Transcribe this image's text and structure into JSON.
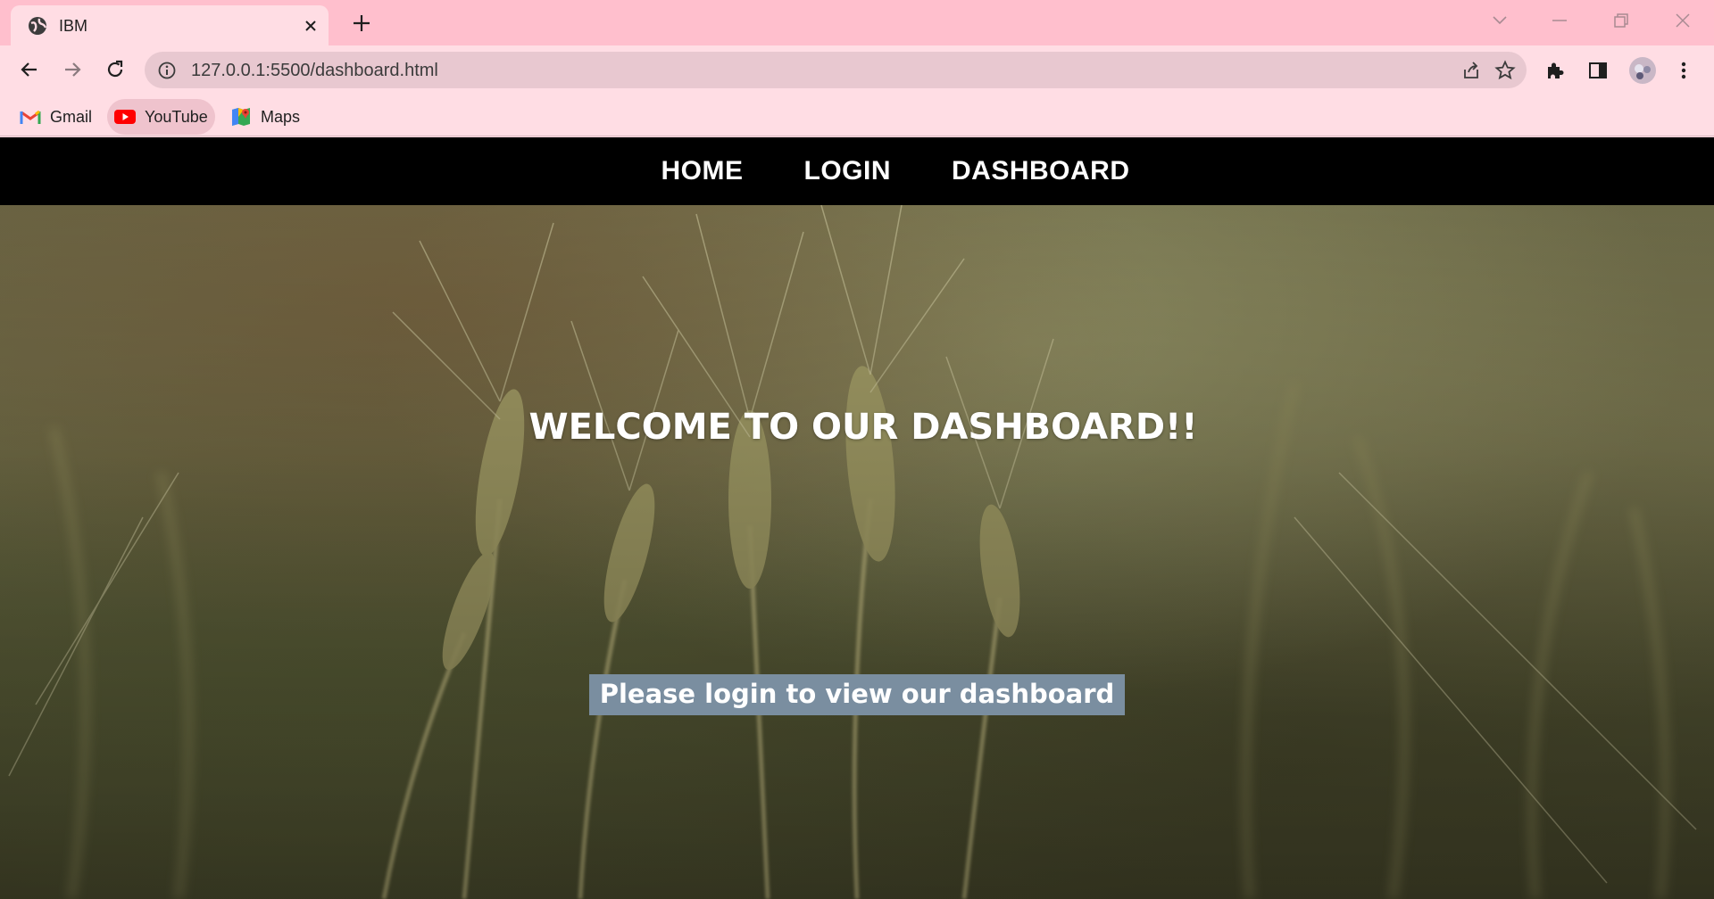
{
  "browser": {
    "tab": {
      "title": "IBM"
    },
    "address_bar": {
      "url": "127.0.0.1:5500/dashboard.html"
    },
    "bookmarks": [
      {
        "label": "Gmail",
        "icon": "gmail-icon"
      },
      {
        "label": "YouTube",
        "icon": "youtube-icon"
      },
      {
        "label": "Maps",
        "icon": "maps-icon"
      }
    ]
  },
  "site": {
    "nav": [
      {
        "label": "HOME"
      },
      {
        "label": "LOGIN"
      },
      {
        "label": "DASHBOARD"
      }
    ],
    "hero": {
      "heading": "WELCOME TO OUR DASHBOARD!!",
      "login_prompt": "Please login to view our dashboard"
    }
  },
  "colors": {
    "tabstrip": "#ffbfcd",
    "toolbar": "#ffdde4",
    "nav_bar": "#000000",
    "login_box": "#7a8ea0"
  }
}
